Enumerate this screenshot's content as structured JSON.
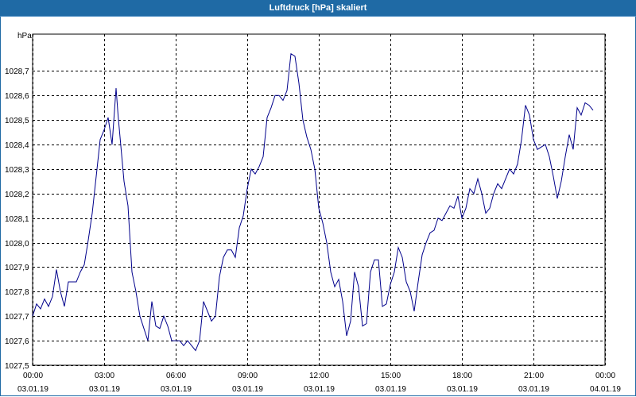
{
  "window": {
    "title": "Luftdruck [hPa] skaliert"
  },
  "colors": {
    "titlebar": "#1f6aa5",
    "line": "#00008b",
    "grid": "#000000"
  },
  "chart_data": {
    "type": "line",
    "title": "Luftdruck [hPa] skaliert",
    "ylabel": "hPa",
    "xlabel": "",
    "ylim": [
      1027.5,
      1028.85
    ],
    "xlim": [
      0,
      24
    ],
    "grid": true,
    "grid_style": "dashed",
    "y_ticks": [
      "1027,5",
      "1027,6",
      "1027,7",
      "1027,8",
      "1027,9",
      "1028,0",
      "1028,1",
      "1028,2",
      "1028,3",
      "1028,4",
      "1028,5",
      "1028,6",
      "1028,7"
    ],
    "x_ticks": [
      {
        "time": "00:00",
        "date": "03.01.19"
      },
      {
        "time": "03:00",
        "date": "03.01.19"
      },
      {
        "time": "06:00",
        "date": "03.01.19"
      },
      {
        "time": "09:00",
        "date": "03.01.19"
      },
      {
        "time": "12:00",
        "date": "03.01.19"
      },
      {
        "time": "15:00",
        "date": "03.01.19"
      },
      {
        "time": "18:00",
        "date": "03.01.19"
      },
      {
        "time": "21:00",
        "date": "03.01.19"
      },
      {
        "time": "00:00",
        "date": "04.01.19"
      }
    ],
    "x": [
      0,
      0.1667,
      0.3333,
      0.5,
      0.6667,
      0.8333,
      1,
      1.1667,
      1.3333,
      1.5,
      1.6667,
      1.8333,
      2,
      2.1667,
      2.3333,
      2.5,
      2.6667,
      2.8333,
      3,
      3.1667,
      3.3333,
      3.5,
      3.5833,
      3.6667,
      3.8333,
      4,
      4.1667,
      4.3333,
      4.5,
      4.6667,
      4.8333,
      5,
      5.1667,
      5.3333,
      5.5,
      5.6667,
      5.8333,
      6,
      6.1667,
      6.3333,
      6.5,
      6.6667,
      6.8333,
      7,
      7.1667,
      7.3333,
      7.5,
      7.6667,
      7.8333,
      8,
      8.1667,
      8.3333,
      8.5,
      8.6667,
      8.8333,
      9,
      9.1667,
      9.3333,
      9.5,
      9.6667,
      9.8333,
      10,
      10.1667,
      10.3333,
      10.5,
      10.6667,
      10.8333,
      11,
      11.1667,
      11.3333,
      11.5,
      11.6667,
      11.8333,
      12,
      12.1667,
      12.3333,
      12.5,
      12.6667,
      12.8333,
      13,
      13.1667,
      13.3333,
      13.5,
      13.6667,
      13.8333,
      14,
      14.1667,
      14.3333,
      14.5,
      14.6667,
      14.8333,
      15,
      15.1667,
      15.3333,
      15.5,
      15.6667,
      15.8333,
      16,
      16.1667,
      16.3333,
      16.5,
      16.6667,
      16.8333,
      17,
      17.1667,
      17.3333,
      17.5,
      17.6667,
      17.8333,
      18,
      18.1667,
      18.3333,
      18.5,
      18.6667,
      18.8333,
      19,
      19.1667,
      19.3333,
      19.5,
      19.6667,
      19.8333,
      20,
      20.1667,
      20.3333,
      20.5,
      20.6667,
      20.8333,
      21,
      21.1667,
      21.3333,
      21.5,
      21.6667,
      21.8333,
      22,
      22.1667,
      22.3333,
      22.5,
      22.6667,
      22.8333,
      23,
      23.1667,
      23.3333,
      23.5,
      23.6667,
      23.8333,
      24
    ],
    "series": [
      {
        "values": [
          1027.7,
          1027.75,
          1027.73,
          1027.77,
          1027.74,
          1027.78,
          1027.89,
          1027.8,
          1027.74,
          1027.84,
          1027.84,
          1027.84,
          1027.88,
          1027.91,
          1028.01,
          1028.12,
          1028.27,
          1028.42,
          1028.46,
          1028.51,
          1028.4,
          1028.63,
          1028.52,
          1028.43,
          1028.25,
          1028.15,
          1027.88,
          1027.8,
          1027.7,
          1027.65,
          1027.6,
          1027.76,
          1027.66,
          1027.65,
          1027.7,
          1027.66,
          1027.6,
          1027.6,
          1027.6,
          1027.58,
          1027.6,
          1027.58,
          1027.56,
          1027.6,
          1027.76,
          1027.72,
          1027.68,
          1027.7,
          1027.86,
          1027.94,
          1027.97,
          1027.97,
          1027.94,
          1028.06,
          1028.11,
          1028.22,
          1028.3,
          1028.28,
          1028.31,
          1028.35,
          1028.51,
          1028.55,
          1028.6,
          1028.6,
          1028.58,
          1028.62,
          1028.77,
          1028.76,
          1028.65,
          1028.5,
          1028.43,
          1028.38,
          1028.3,
          1028.14,
          1028.08,
          1028.0,
          1027.88,
          1027.82,
          1027.85,
          1027.76,
          1027.62,
          1027.68,
          1027.88,
          1027.82,
          1027.66,
          1027.67,
          1027.88,
          1027.93,
          1027.93,
          1027.74,
          1027.75,
          1027.83,
          1027.88,
          1027.98,
          1027.94,
          1027.84,
          1027.8,
          1027.72,
          1027.84,
          1027.95,
          1028.0,
          1028.04,
          1028.05,
          1028.1,
          1028.09,
          1028.12,
          1028.15,
          1028.14,
          1028.19,
          1028.1,
          1028.14,
          1028.22,
          1028.2,
          1028.26,
          1028.2,
          1028.12,
          1028.14,
          1028.2,
          1028.24,
          1028.22,
          1028.26,
          1028.3,
          1028.28,
          1028.32,
          1028.42,
          1028.56,
          1028.52,
          1028.42,
          1028.38,
          1028.39,
          1028.4,
          1028.35,
          1028.27,
          1028.18,
          1028.25,
          1028.35,
          1028.44,
          1028.38,
          1028.55,
          1028.52,
          1028.57,
          1028.56,
          1028.54
        ]
      }
    ]
  }
}
